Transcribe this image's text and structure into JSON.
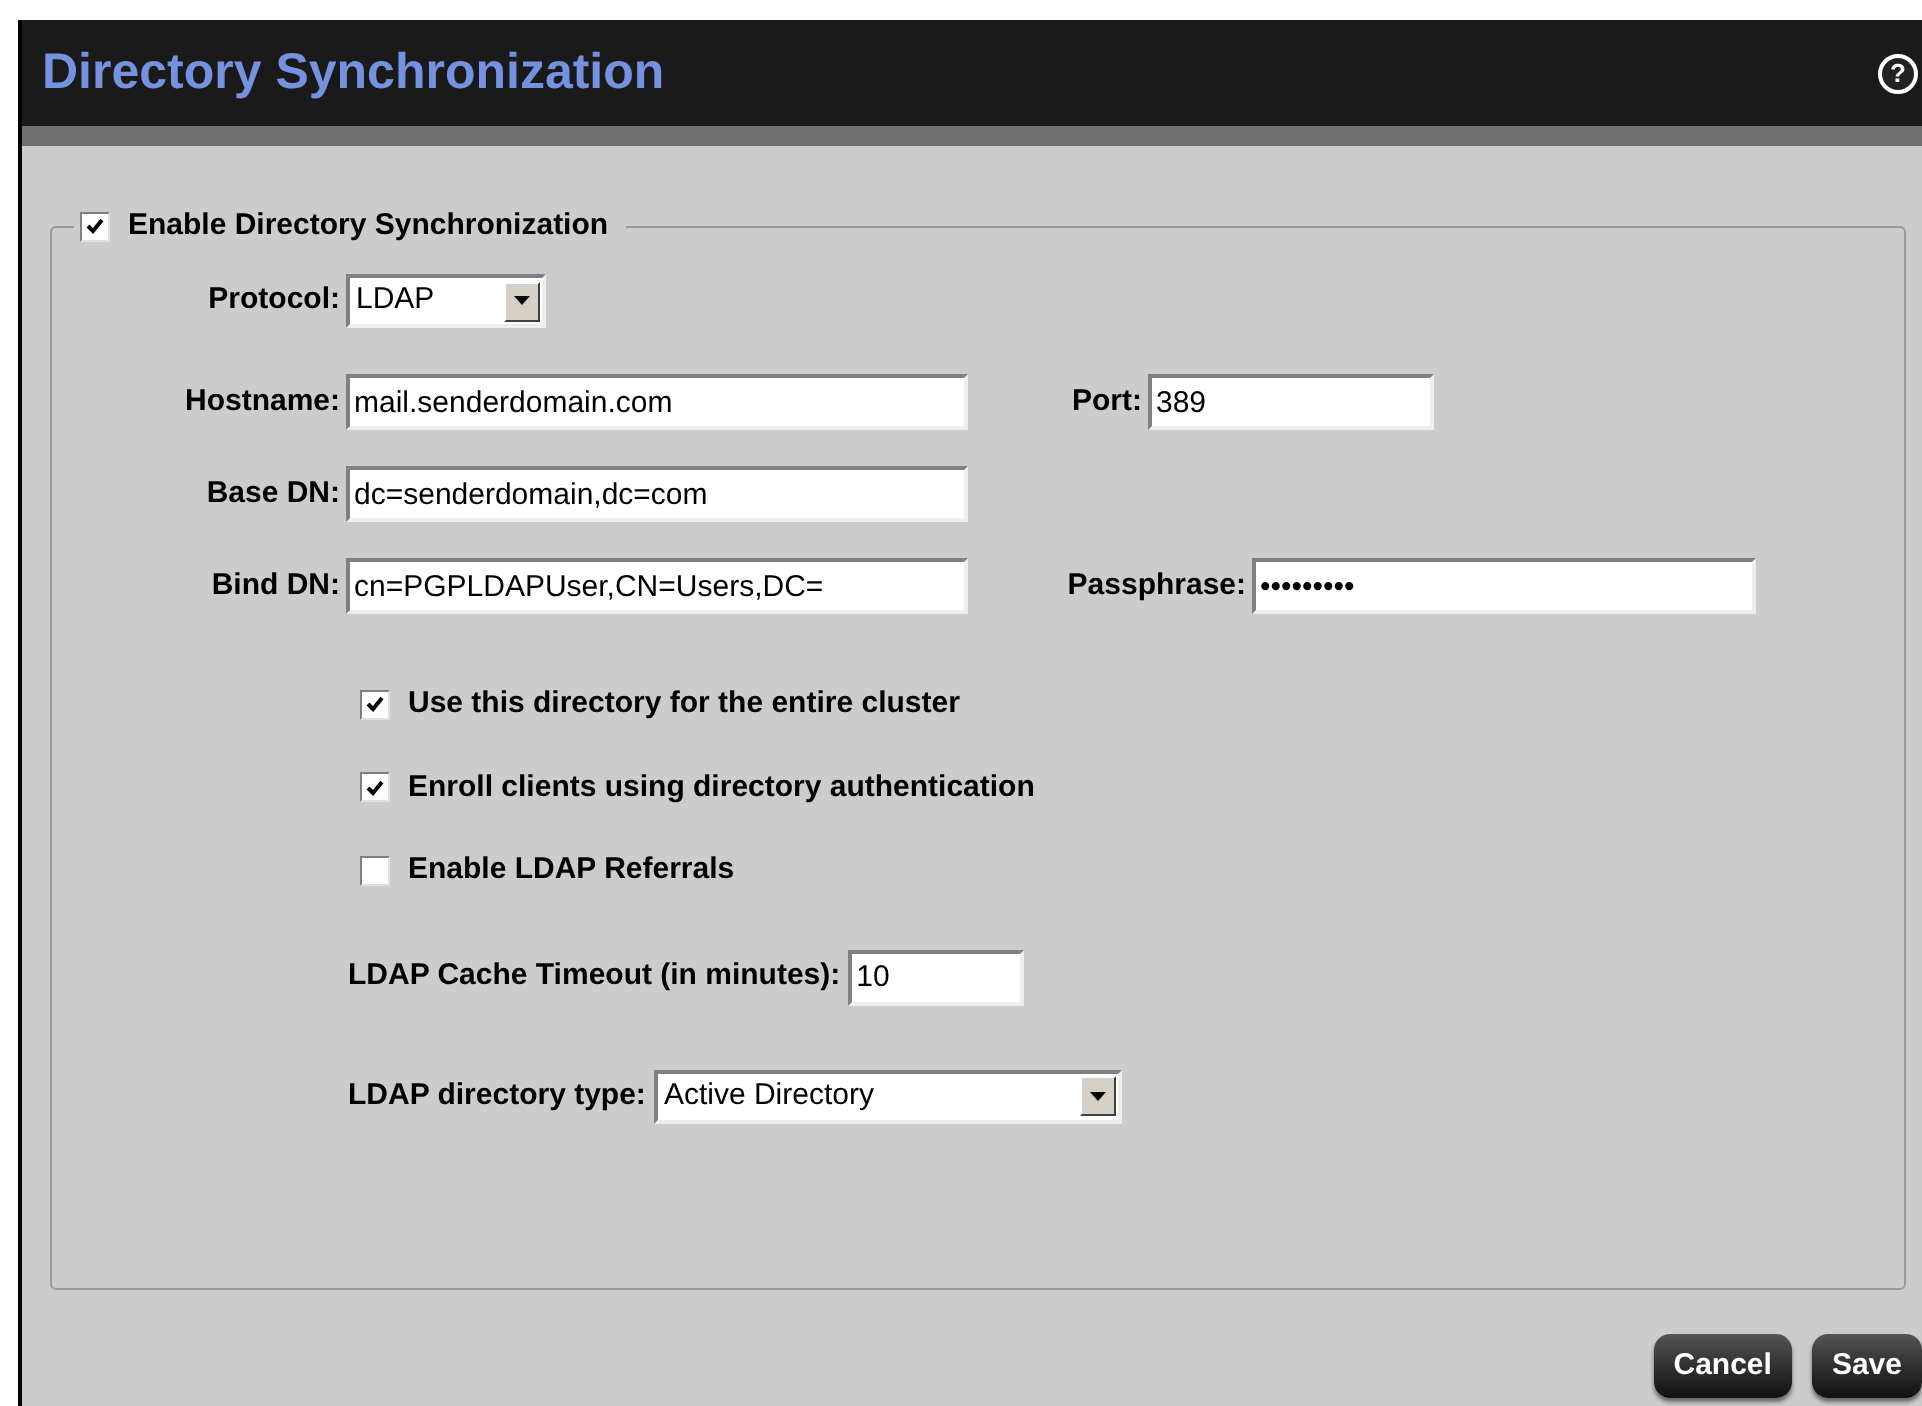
{
  "window": {
    "title": "Directory Synchronization",
    "help": "?"
  },
  "section": {
    "label": "Enable Directory Synchronization",
    "checked": true
  },
  "protocol": {
    "label": "Protocol:",
    "value": "LDAP"
  },
  "hostname": {
    "label": "Hostname:",
    "value": "mail.senderdomain.com"
  },
  "port": {
    "label": "Port:",
    "value": "389"
  },
  "base_dn": {
    "label": "Base DN:",
    "value": "dc=senderdomain,dc=com"
  },
  "bind_dn": {
    "label": "Bind DN:",
    "value": "cn=PGPLDAPUser,CN=Users,DC="
  },
  "passphrase": {
    "label": "Passphrase:",
    "value": "•••••••••"
  },
  "options": [
    {
      "label": "Use this directory for the entire cluster",
      "checked": true
    },
    {
      "label": "Enroll clients using directory authentication",
      "checked": true
    },
    {
      "label": "Enable LDAP Referrals",
      "checked": false
    }
  ],
  "cache_timeout": {
    "label": "LDAP Cache Timeout (in minutes):",
    "value": "10"
  },
  "directory_type": {
    "label": "LDAP directory type:",
    "value": "Active Directory"
  },
  "buttons": [
    "Cancel",
    "Save"
  ]
}
